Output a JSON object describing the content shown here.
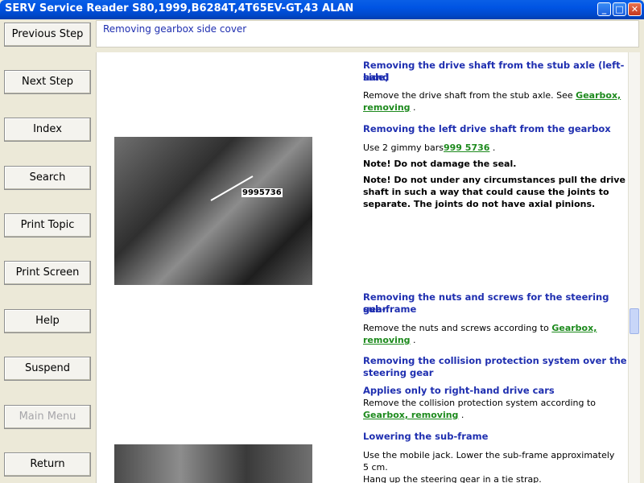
{
  "window": {
    "title": "SERV Service Reader S80,1999,B6284T,4T65EV-GT,43 ALAN"
  },
  "titlebar": {
    "min_glyph": "_",
    "max_glyph": "□",
    "close_glyph": "✕"
  },
  "sidebar": {
    "buttons": [
      {
        "label": "Previous Step",
        "enabled": true
      },
      {
        "label": "Next Step",
        "enabled": true
      },
      {
        "label": "Index",
        "enabled": true
      },
      {
        "label": "Search",
        "enabled": true
      },
      {
        "label": "Print Topic",
        "enabled": true
      },
      {
        "label": "Print Screen",
        "enabled": true
      },
      {
        "label": "Help",
        "enabled": true
      },
      {
        "label": "Suspend",
        "enabled": true
      },
      {
        "label": "Main Menu",
        "enabled": false
      },
      {
        "label": "Return",
        "enabled": true
      }
    ]
  },
  "header": {
    "title": "Removing gearbox side cover"
  },
  "figure1": {
    "callout": "9995736"
  },
  "content": {
    "s1": {
      "h1": "Removing the drive shaft from the stub axle (left-hand",
      "h2": "side)"
    },
    "s1p": {
      "pre": "Remove the drive shaft from the stub axle. See ",
      "link1": "Gearbox,",
      "link2": "removing",
      "post": " ."
    },
    "s2": {
      "h": "Removing the left drive shaft from the gearbox"
    },
    "s2p": {
      "pre": "Use 2 gimmy bars",
      "link": "999 5736",
      "post": " ."
    },
    "note1": "Note! Do not damage the seal.",
    "note2": {
      "l1": "Note! Do not under any circumstances pull the drive",
      "l2": "shaft in such a way that could cause the joints to",
      "l3": "separate. The joints do not have axial pinions."
    },
    "s3": {
      "h1": "Removing the nuts and screws for the steering gear",
      "h2": "sub-frame"
    },
    "s3p": {
      "pre": "Remove the nuts and screws according to ",
      "link1": "Gearbox,",
      "link2": "removing",
      "post": " ."
    },
    "s4": {
      "h1": "Removing the collision protection system over the",
      "h2": "steering gear"
    },
    "s5": {
      "h": "Applies only to right-hand drive cars"
    },
    "s5p": {
      "l1": "Remove the collision protection system according to",
      "link": "Gearbox, removing",
      "post": " ."
    },
    "s6": {
      "h": "Lowering the sub-frame"
    },
    "s6p": {
      "l1": "Use the mobile jack. Lower the sub-frame approximately",
      "l2": "5 cm.",
      "l3": "Hang up the steering gear in a tie strap."
    }
  }
}
